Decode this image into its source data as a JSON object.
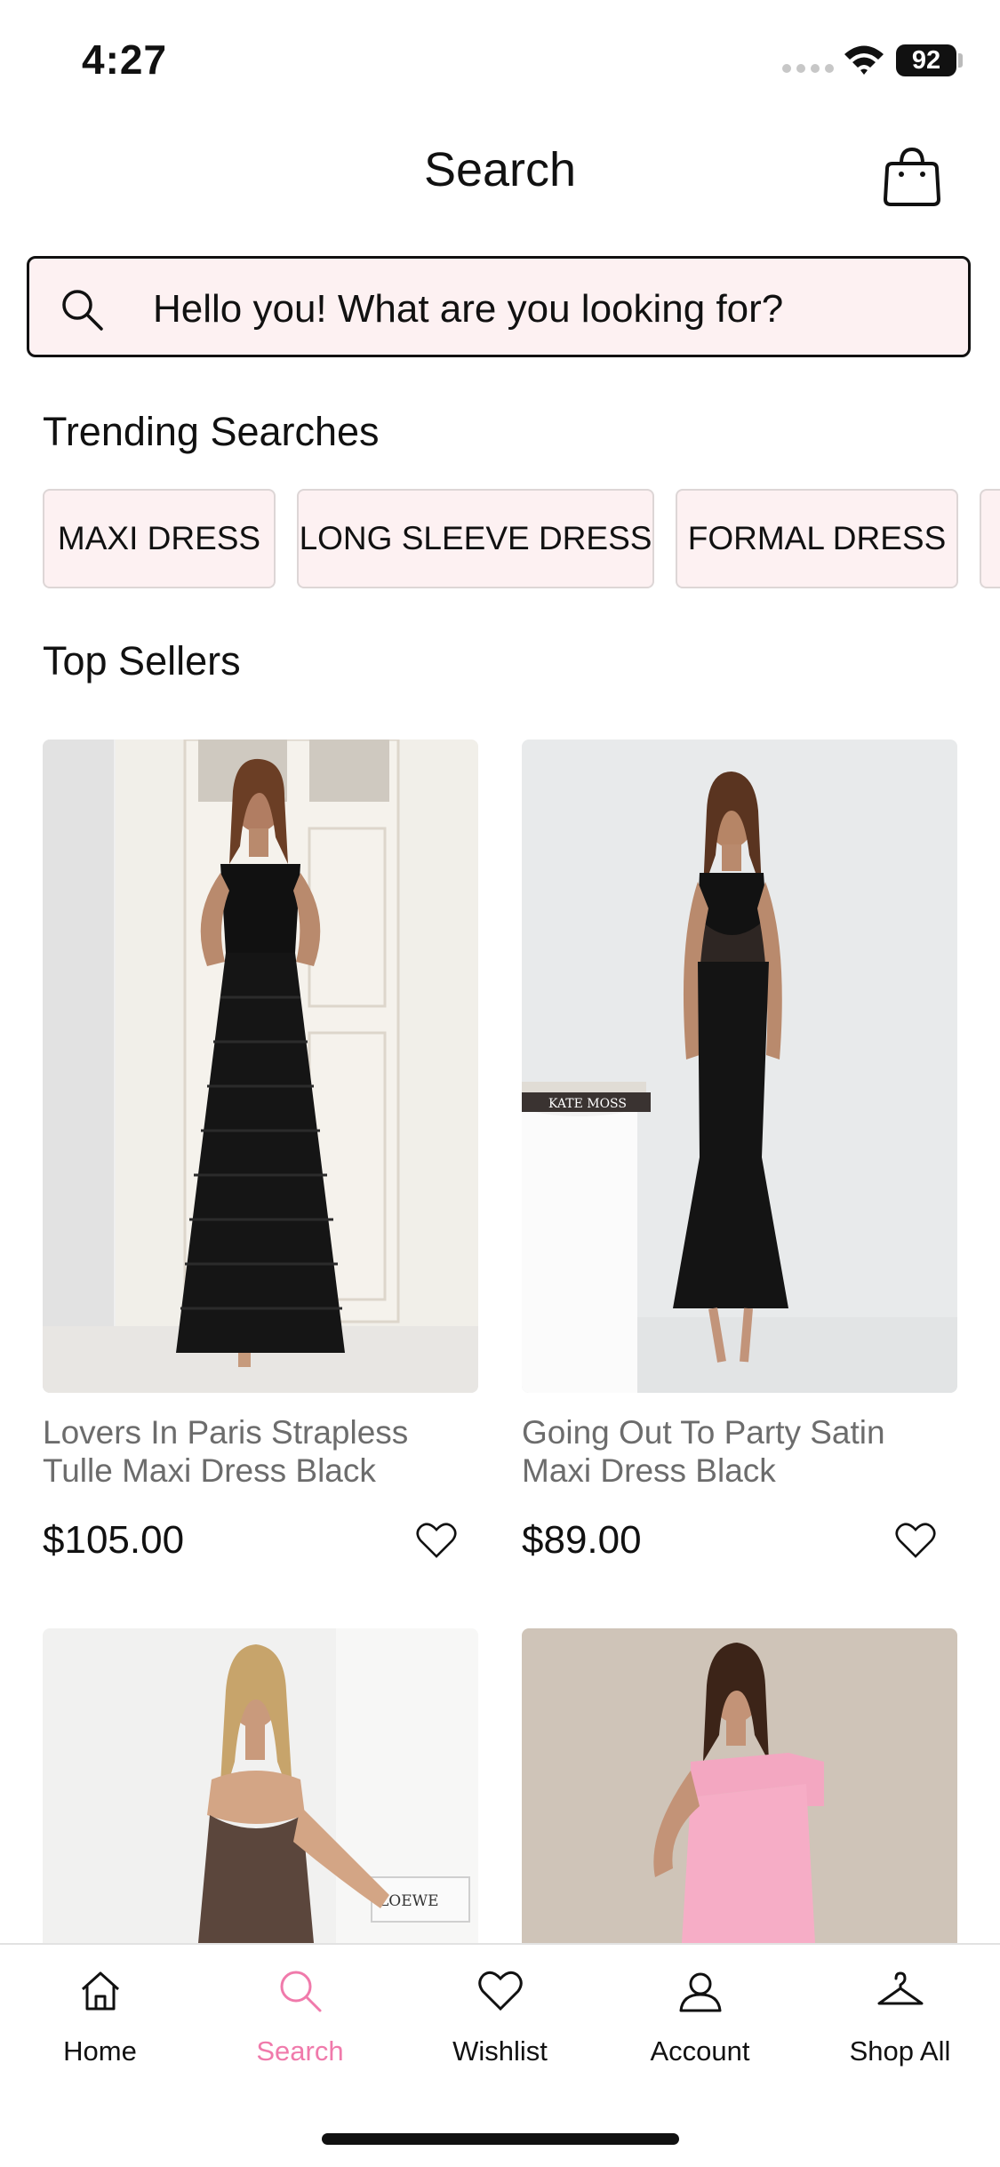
{
  "status_bar": {
    "time": "4:27",
    "battery": "92"
  },
  "header": {
    "title": "Search"
  },
  "search": {
    "placeholder": "Hello you! What are you looking for?"
  },
  "trending": {
    "title": "Trending Searches",
    "chips": [
      "MAXI DRESS",
      "LONG SLEEVE DRESS",
      "FORMAL DRESS"
    ]
  },
  "top_sellers": {
    "title": "Top Sellers",
    "products": [
      {
        "name": "Lovers In Paris Strapless Tulle Maxi Dress Black",
        "price": "$105.00"
      },
      {
        "name": "Going Out To Party Satin Maxi Dress Black",
        "price": "$89.00"
      },
      {
        "name": "",
        "price": ""
      },
      {
        "name": "",
        "price": ""
      }
    ],
    "image_text": {
      "book_spine_1": "KATE MOSS",
      "book_spine_2": "LOEWE"
    }
  },
  "tab_bar": {
    "items": [
      {
        "label": "Home",
        "icon": "home-icon"
      },
      {
        "label": "Search",
        "icon": "search-icon",
        "active": true
      },
      {
        "label": "Wishlist",
        "icon": "heart-icon"
      },
      {
        "label": "Account",
        "icon": "user-icon"
      },
      {
        "label": "Shop All",
        "icon": "hanger-icon"
      }
    ]
  },
  "colors": {
    "accent_pink": "#f07aab",
    "chip_bg": "#fdf1f2",
    "text": "#111111",
    "muted_text": "#6c6c6c"
  }
}
